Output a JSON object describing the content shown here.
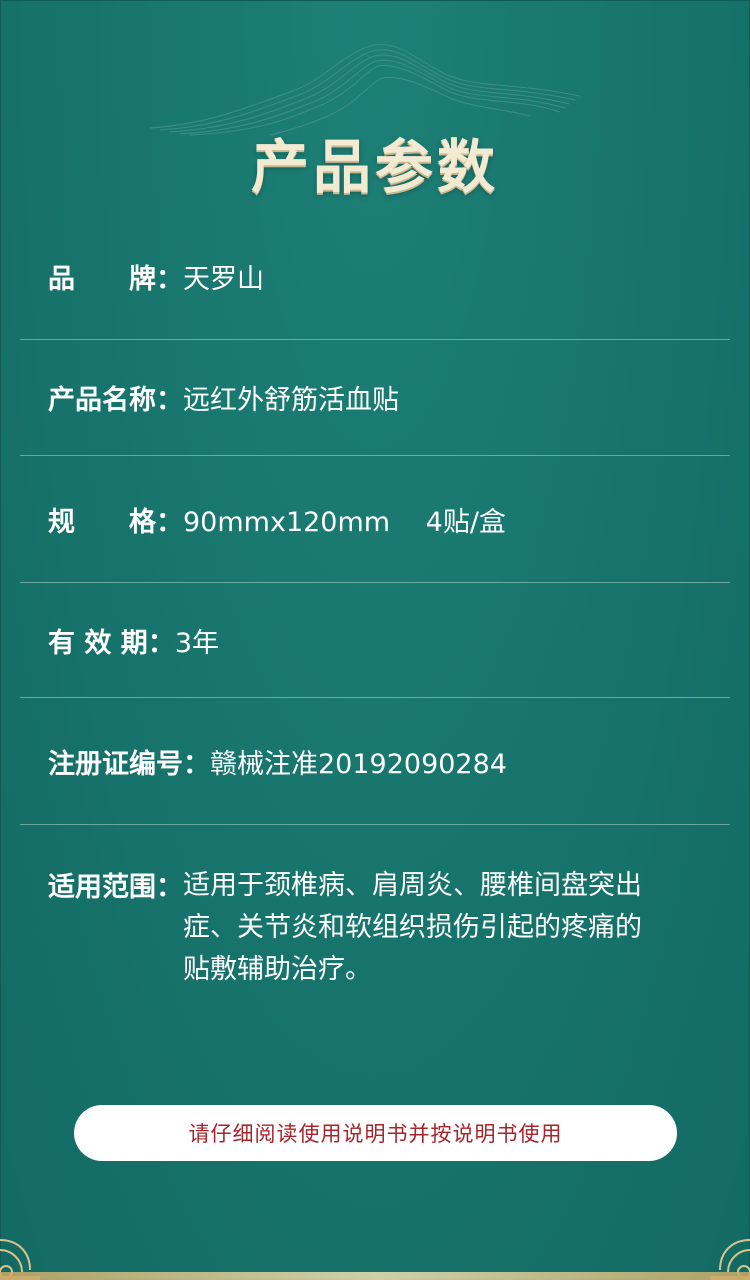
{
  "title": "产品参数",
  "params": [
    {
      "label": "品　　牌：",
      "value": "天罗山"
    },
    {
      "label": "产品名称：",
      "value": "远红外舒筋活血贴"
    },
    {
      "label": "规　　格：",
      "value": "90mmx120mm　 4贴/盒"
    },
    {
      "label": "有 效 期：",
      "value": "3年"
    },
    {
      "label": "注册证编号：",
      "value": "赣械注准20192090284"
    },
    {
      "label": "适用范围：",
      "value": "适用于颈椎病、肩周炎、腰椎间盘突出症、关节炎和软组织损伤引起的疼痛的贴敷辅助治疗。"
    }
  ],
  "notice": "请仔细阅读使用说明书并按说明书使用",
  "colors": {
    "background": "#17746c",
    "title": "#f3ead4",
    "notice_text": "#a9242a",
    "gold": "#c9a968"
  },
  "icons": {
    "header_ornament": "mountain-lines-icon",
    "corner_ornament": "cloud-corner-icon"
  }
}
